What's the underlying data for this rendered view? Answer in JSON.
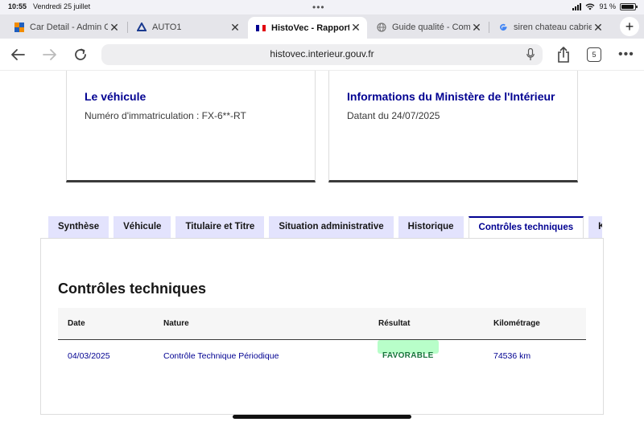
{
  "status_bar": {
    "time": "10:55",
    "date": "Vendredi 25 juillet",
    "battery": "91 %",
    "battery_level": 0.91
  },
  "browser_tabs": [
    {
      "title": "Car Detail - Admin C",
      "favicon": "grid-icon"
    },
    {
      "title": "AUTO1",
      "favicon": "auto1-icon"
    },
    {
      "title": "HistoVec - Rapport v",
      "favicon": "french-flag-icon",
      "active": true
    },
    {
      "title": "Guide qualité - Com",
      "favicon": "globe-icon"
    },
    {
      "title": "siren chateau cabrie",
      "favicon": "google-icon"
    }
  ],
  "toolbar": {
    "url": "histovec.interieur.gouv.fr",
    "tab_count": "5"
  },
  "cards": {
    "vehicle": {
      "title": "Le véhicule",
      "line": "Numéro d'immatriculation : FX-6**-RT"
    },
    "ministry": {
      "title": "Informations du Ministère de l'Intérieur",
      "line": "Datant du 24/07/2025"
    }
  },
  "page_tabs": [
    "Synthèse",
    "Véhicule",
    "Titulaire et Titre",
    "Situation administrative",
    "Historique",
    "Contrôles techniques",
    "Kilométrage"
  ],
  "active_page_tab": "Contrôles techniques",
  "section": {
    "title": "Contrôles techniques",
    "headers": {
      "date": "Date",
      "nature": "Nature",
      "result": "Résultat",
      "mileage": "Kilométrage"
    },
    "rows": [
      {
        "date": "04/03/2025",
        "nature": "Contrôle Technique Périodique",
        "result": "FAVORABLE",
        "mileage": "74536 km"
      }
    ]
  },
  "colors": {
    "primary": "#000091",
    "tab_bg": "#e3e3fd",
    "badge_bg": "#b8fec9",
    "badge_text": "#18753c"
  }
}
